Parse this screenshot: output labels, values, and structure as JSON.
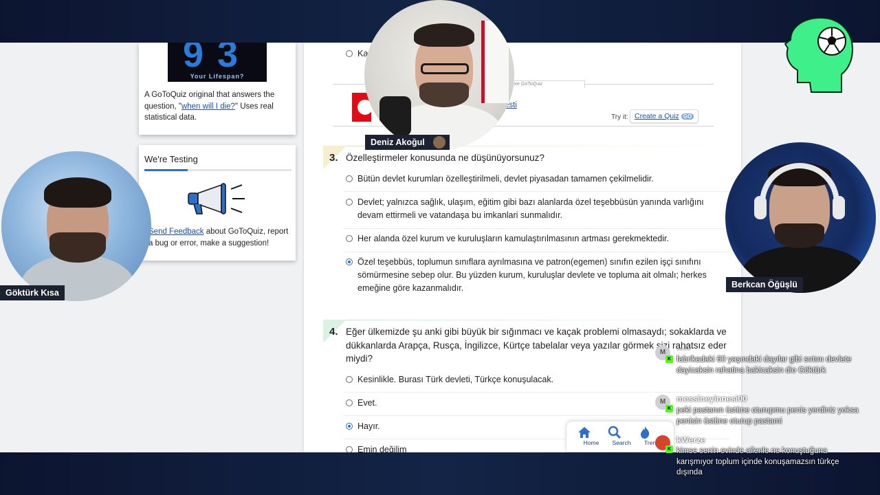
{
  "sidebar": {
    "lifespan_card": {
      "image_digits": "93",
      "image_caption": "Your Lifespan?",
      "text_before": "A GoToQuiz original that answers the question, \"",
      "link_text": "when will I die?",
      "text_after": "\" Uses real statistical data."
    },
    "testing_card": {
      "title": "We're Testing",
      "link_text": "Send Feedback",
      "text_after": " about GoToQuiz, report a bug or error, make a suggestion!"
    }
  },
  "quiz": {
    "prev_option": "Ka",
    "tryit": {
      "more_label": "More GoToQuiz",
      "link_text": "esti",
      "try_label": "Try it:",
      "create_label": "Create a Quiz",
      "create_badge": "GO"
    },
    "questions": [
      {
        "number": "3.",
        "text": "Özelleştirmeler konusunda ne düşünüyorsunuz?",
        "options": [
          {
            "label": "Bütün devlet kurumları özelleştirilmeli, devlet piyasadan tamamen çekilmelidir.",
            "selected": false
          },
          {
            "label": "Devlet; yalnızca sağlık, ulaşım, eğitim gibi bazı alanlarda özel teşebbüsün yanında varlığını devam ettirmeli ve vatandaşa bu imkanlari sunmalıdır.",
            "selected": false
          },
          {
            "label": "Her alanda özel kurum ve kuruluşların kamulaştırılmasının artması gerekmektedir.",
            "selected": false
          },
          {
            "label": "Özel teşebbüs, toplumun sınıflara ayrılmasına ve patron(egemen) sınıfın ezilen işçi sınıfını sömürmesine sebep olur. Bu yüzden kurum, kuruluşlar devlete ve topluma ait olmalı; herkes emeğine göre kazanmalıdır.",
            "selected": true
          }
        ]
      },
      {
        "number": "4.",
        "text": "Eğer ülkemizde şu anki gibi büyük bir sığınmacı ve kaçak problemi olmasaydı; sokaklarda ve dükkanlarda Arapça, Rusça, İngilizce, Kürtçe tabelalar veya yazılar görmek sizi rahatsız eder miydi?",
        "options": [
          {
            "label": "Kesinlikle. Burası Türk devleti, Türkçe konuşulacak.",
            "selected": false
          },
          {
            "label": "Evet.",
            "selected": false
          },
          {
            "label": "Hayır.",
            "selected": true
          },
          {
            "label": "Emin değilim",
            "selected": false
          }
        ]
      }
    ]
  },
  "bottom_nav": [
    {
      "label": "Home",
      "icon": "home-icon"
    },
    {
      "label": "Search",
      "icon": "search-icon"
    },
    {
      "label": "Trend",
      "icon": "fire-icon"
    }
  ],
  "streamers": {
    "left": "Göktürk Kısa",
    "top": "Deniz Akoğul",
    "right": "Berkcan Öğüşlü"
  },
  "chat": [
    {
      "initial": "M",
      "user": "…n",
      "text": "fabrikadaki 60 yaşındaki dayılar gibi sırtını devlete dayicaksin rahatina bakicaksin dio Göktürk"
    },
    {
      "initial": "M",
      "user": "messineyinnesi00",
      "text": "peki pastanın üstüne oturupmu penis yerdiniz yoksa penisin üstüne oturup pastami"
    },
    {
      "initial": "",
      "user": "kWerze",
      "text": "kimse senin evinde ailenle ne konuştuğuna karışmıyor toplum içinde konuşamazsın türkçe dışında"
    }
  ],
  "colors": {
    "accent": "#2f6ec9",
    "logo_green": "#3ff08a",
    "kick_green": "#53fc18"
  }
}
